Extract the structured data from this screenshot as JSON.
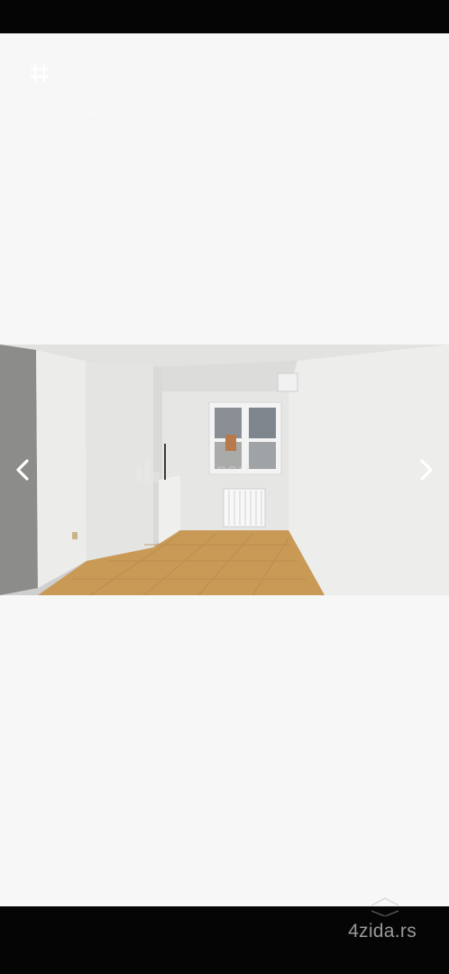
{
  "header": {
    "faint_label": "Nekretnine"
  },
  "viewer": {
    "watermark_text": "cityexpert",
    "prev_icon": "chevron-left-icon",
    "next_icon": "chevron-right-icon"
  },
  "footer": {
    "site_logo": "4zida.rs"
  },
  "colors": {
    "page_background": "#f7f7f7",
    "bars": "#050505",
    "wall": "#e8e8e6",
    "floor": "#c89a56"
  }
}
